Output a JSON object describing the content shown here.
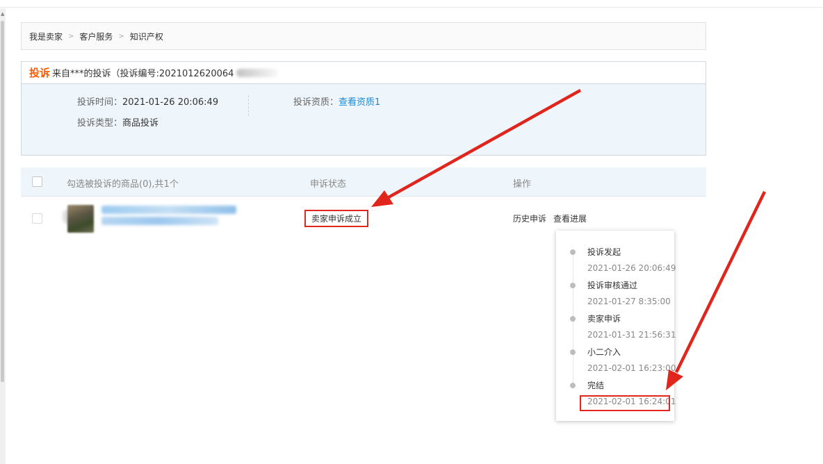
{
  "breadcrumb": [
    "我是卖家",
    "客户服务",
    "知识产权"
  ],
  "breadcrumb_separator": ">",
  "complaint": {
    "tag": "投诉",
    "title": "来自***的投诉（投诉编号:2021012620064",
    "time_label": "投诉时间：",
    "time_value": "2021-01-26 20:06:49",
    "type_label": "投诉类型：",
    "type_value": "商品投诉",
    "credential_label": "投诉资质：",
    "credential_link": "查看资质1"
  },
  "table": {
    "col_select": "勾选被投诉的商品(0),共1个",
    "col_status": "申诉状态",
    "col_action": "操作",
    "rows": [
      {
        "status": "卖家申诉成立",
        "actions": [
          "历史申诉",
          "查看进展"
        ]
      }
    ]
  },
  "progress": {
    "steps": [
      {
        "name": "投诉发起",
        "time": "2021-01-26 20:06:49"
      },
      {
        "name": "投诉审核通过",
        "time": "2021-01-27 8:35:00"
      },
      {
        "name": "卖家申诉",
        "time": "2021-01-31 21:56:31"
      },
      {
        "name": "小二介入",
        "time": "2021-02-01 16:23:00"
      },
      {
        "name": "完结",
        "time": "2021-02-01 16:24:01"
      }
    ]
  },
  "colors": {
    "accent_orange": "#ff5a00",
    "link_blue": "#1a8bd8",
    "annotation_red": "#e0261c",
    "panel_bg": "#eef5fb"
  }
}
